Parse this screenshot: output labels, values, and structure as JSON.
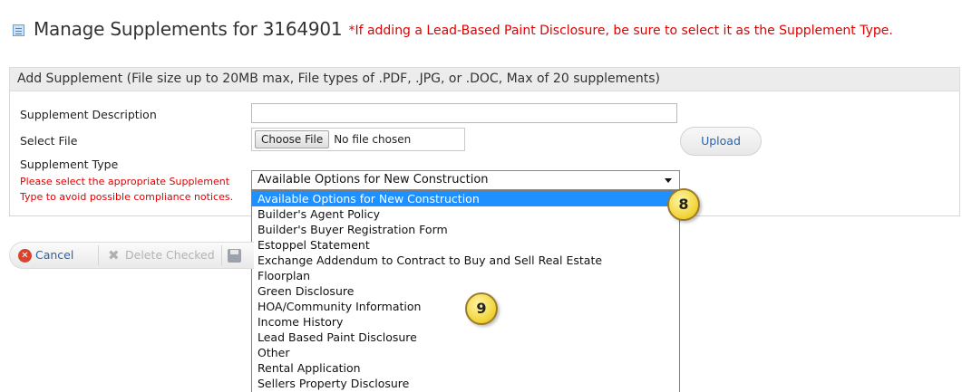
{
  "header": {
    "title": "Manage Supplements for 3164901",
    "note": "*If adding a Lead-Based Paint Disclosure, be sure to select it as the Supplement Type."
  },
  "panel": {
    "heading": "Add Supplement (File size up to 20MB max, File types of .PDF, .JPG, or .DOC, Max of 20 supplements)"
  },
  "form": {
    "description_label": "Supplement Description",
    "description_value": "",
    "file_label": "Select File",
    "choose_file_label": "Choose File",
    "no_file_text": "No file chosen",
    "upload_label": "Upload",
    "type_label": "Supplement Type",
    "type_warning_line1": "Please select the appropriate Supplement",
    "type_warning_line2": "Type to avoid possible compliance notices.",
    "type_selected": "Available Options for New Construction"
  },
  "dropdown": {
    "options": [
      "Available Options for New Construction",
      "Builder's Agent Policy",
      "Builder's Buyer Registration Form",
      "Estoppel Statement",
      "Exchange Addendum to Contract to Buy and Sell Real Estate",
      "Floorplan",
      "Green Disclosure",
      "HOA/Community Information",
      "Income History",
      "Lead Based Paint Disclosure",
      "Other",
      "Rental Application",
      "Sellers Property Disclosure"
    ],
    "highlighted_index": 0
  },
  "toolbar": {
    "cancel_label": "Cancel",
    "delete_label": "Delete Checked"
  },
  "callouts": {
    "step8": "8",
    "step9": "9"
  },
  "colors": {
    "warning": "#e00000",
    "link": "#2a62a9",
    "highlight": "#1e90ff",
    "callout": "#f2d53a"
  }
}
